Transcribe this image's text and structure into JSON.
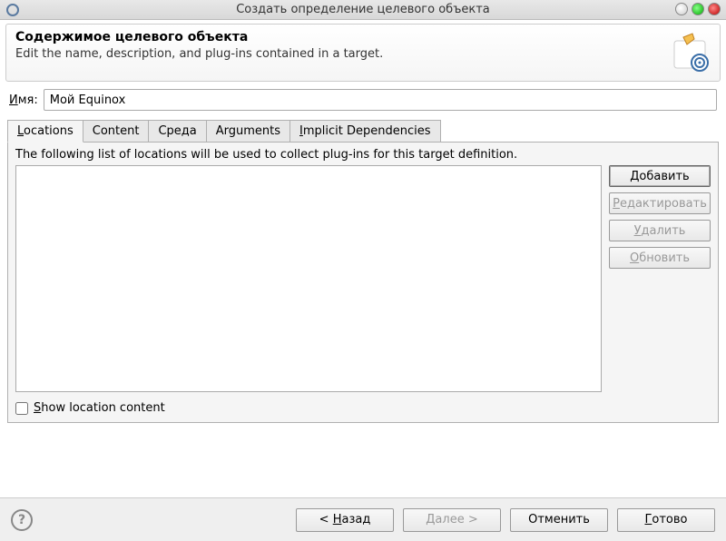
{
  "window": {
    "title": "Создать определение целевого объекта"
  },
  "header": {
    "title": "Содержимое целевого объекта",
    "subtitle": "Edit the name, description, and plug-ins contained in a target."
  },
  "name_field": {
    "label_prefix": "И",
    "label_rest": "мя:",
    "value": "Мой Equinox"
  },
  "tabs": {
    "items": [
      {
        "prefix": "L",
        "rest": "ocations",
        "active": true
      },
      {
        "prefix": "",
        "rest": "Content",
        "active": false
      },
      {
        "prefix": "",
        "rest": "Среда",
        "active": false
      },
      {
        "prefix": "",
        "rest": "Arguments",
        "active": false
      },
      {
        "prefix": "I",
        "rest": "mplicit Dependencies",
        "active": false
      }
    ],
    "locations": {
      "description": "The following list of locations will be used to collect plug-ins for this target definition.",
      "buttons": {
        "add_prefix": "Д",
        "add_rest": "обавить",
        "edit_prefix": "Р",
        "edit_rest": "едактировать",
        "remove_prefix": "У",
        "remove_rest": "далить",
        "update_prefix": "О",
        "update_rest": "бновить"
      },
      "checkbox_prefix": "S",
      "checkbox_rest": "how location content"
    }
  },
  "footer": {
    "back_prefix": "Н",
    "back_rest": "азад",
    "next_prefix": "Д",
    "next_rest": "алее",
    "cancel": "Отменить",
    "finish_prefix": "Г",
    "finish_rest": "отово"
  }
}
